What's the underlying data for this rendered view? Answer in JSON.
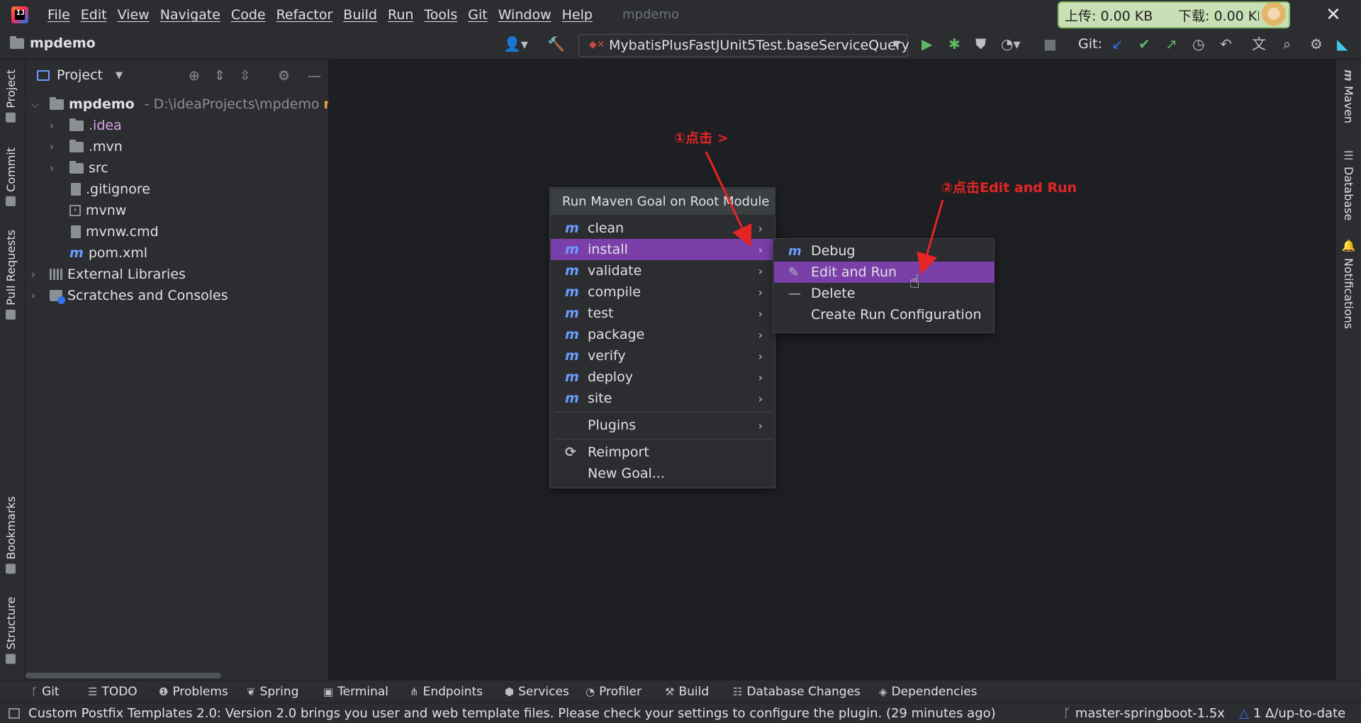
{
  "menubar": {
    "items": [
      "File",
      "Edit",
      "View",
      "Navigate",
      "Code",
      "Refactor",
      "Build",
      "Run",
      "Tools",
      "Git",
      "Window",
      "Help"
    ],
    "window_title": "mpdemo",
    "net_up": "上传: 0.00 KB",
    "net_down": "下载: 0.00 KB"
  },
  "toolbar": {
    "project_name": "mpdemo",
    "run_config": "MybatisPlusFastJUnit5Test.baseServiceQuery",
    "git_label": "Git:"
  },
  "left_tabs": [
    "Project",
    "Commit",
    "Pull Requests",
    "Bookmarks",
    "Structure"
  ],
  "right_tabs": [
    "Maven",
    "Database",
    "Notifications"
  ],
  "project_panel": {
    "title": "Project",
    "root": {
      "name": "mpdemo",
      "path": "- D:\\ideaProjects\\mpdemo",
      "branch": "mas"
    },
    "items": [
      ".idea",
      ".mvn",
      "src",
      ".gitignore",
      "mvnw",
      "mvnw.cmd",
      "pom.xml",
      "External Libraries",
      "Scratches and Consoles"
    ]
  },
  "editor": {
    "hint_fragment": "m"
  },
  "context_menu": {
    "header": "Run Maven Goal on Root Module",
    "goals": [
      "clean",
      "install",
      "validate",
      "compile",
      "test",
      "package",
      "verify",
      "deploy",
      "site"
    ],
    "plugins": "Plugins",
    "reimport": "Reimport",
    "new_goal": "New Goal..."
  },
  "submenu": {
    "items": [
      "Debug",
      "Edit and Run",
      "Delete",
      "Create Run Configuration"
    ]
  },
  "annotations": {
    "step1": "①点击 >",
    "step2": "②点击Edit and Run"
  },
  "bottom_tabs": [
    "Git",
    "TODO",
    "Problems",
    "Spring",
    "Terminal",
    "Endpoints",
    "Services",
    "Profiler",
    "Build",
    "Database Changes",
    "Dependencies"
  ],
  "status": {
    "message": "Custom Postfix Templates 2.0: Version 2.0 brings you user and web template files. Please check your settings to configure the plugin. (29 minutes ago)",
    "branch": "master-springboot-1.5x",
    "sync": "1 Δ/up-to-date"
  },
  "colors": {
    "selection": "#7a3fa8",
    "annotation": "#e52525",
    "maven_icon": "#6b9bfa"
  }
}
